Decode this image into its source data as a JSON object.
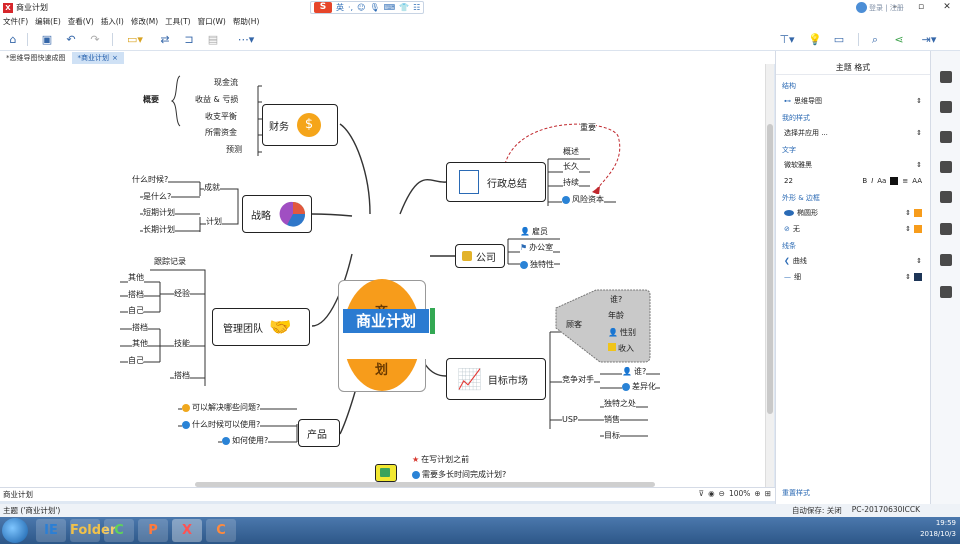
{
  "window": {
    "title": "商业计划",
    "app_icon": "X"
  },
  "ime": {
    "logo": "S",
    "lang": "英",
    "items": [
      "·,",
      "☺",
      "🎙",
      "⌨",
      "👕",
      "☷"
    ]
  },
  "login": {
    "label": "登录 | 注册"
  },
  "menu": [
    "文件(F)",
    "编辑(E)",
    "查看(V)",
    "插入(I)",
    "修改(M)",
    "工具(T)",
    "窗口(W)",
    "帮助(H)"
  ],
  "tabs": [
    {
      "label": "*思维导图快速成图",
      "active": false
    },
    {
      "label": "*商业计划",
      "active": true,
      "close": "×"
    }
  ],
  "mindmap": {
    "central": {
      "label": "商业计划",
      "char_top": "商",
      "char_bottom": "划",
      "fill": "#f79c1b",
      "label_bg": "#2b7bd1"
    },
    "finance": {
      "label": "财务",
      "summary": "概要",
      "items": [
        "现金流",
        "收益 & 亏损",
        "收支平衡",
        "所需资金",
        "预测"
      ]
    },
    "strategy": {
      "label": "战略",
      "success": "成就",
      "when": "什么时候?",
      "what": "是什么?",
      "plan": "计划",
      "short": "短期计划",
      "long": "长期计划"
    },
    "team": {
      "label": "管理团队",
      "track": "跟踪记录",
      "experience": "经验",
      "skills": "技能",
      "exp_items": [
        "其他",
        "搭档",
        "自己"
      ],
      "skill_items": [
        "搭档",
        "其他",
        "自己"
      ]
    },
    "product": {
      "label": "产品",
      "items": [
        "可以解决哪些问题?",
        "什么时候可以使用?",
        "如何使用?"
      ]
    },
    "admin": {
      "label": "行政总结",
      "items": [
        "概述",
        "长久",
        "持续",
        "风险资本"
      ],
      "important": "重要"
    },
    "company": {
      "label": "公司",
      "items": [
        "雇员",
        "办公室",
        "独特性"
      ]
    },
    "market": {
      "label": "目标市场",
      "customers": "顾客",
      "who": "谁?",
      "age": "年龄",
      "gender": "性别",
      "income": "收入",
      "competitor": "竞争对手",
      "comp_who": "谁?",
      "difference": "差异化",
      "usp": "USP",
      "unique": "独特之处",
      "sales": "销售",
      "target": "目标"
    },
    "bottom_topic": {
      "items": [
        "在写计划之前",
        "需要多长时间完成计划?"
      ]
    }
  },
  "status": {
    "sheet": "商业计划",
    "topic": "主题 ('商业计划')",
    "zoom": "100%",
    "autosave": "自动保存: 关闭",
    "pc": "PC-20170630ICCK"
  },
  "panel": {
    "title": "主题 格式",
    "structure_label": "结构",
    "structure_value": "思维导图",
    "style_label": "我的样式",
    "style_value": "选择并应用 ...",
    "text_label": "文字",
    "font_value": "微软雅黑",
    "font_size": "22",
    "shape_label": "外形 & 边框",
    "shape_value": "椭圆形",
    "fill_value": "无",
    "line_label": "线条",
    "line_value": "曲线",
    "line_weight": "细",
    "reset": "重置样式",
    "accent": "#f79c1b"
  },
  "taskbar": {
    "clock_time": "19:59",
    "clock_date": "2018/10/3",
    "apps": [
      "IE",
      "Folder",
      "C",
      "P",
      "X",
      "C"
    ]
  }
}
